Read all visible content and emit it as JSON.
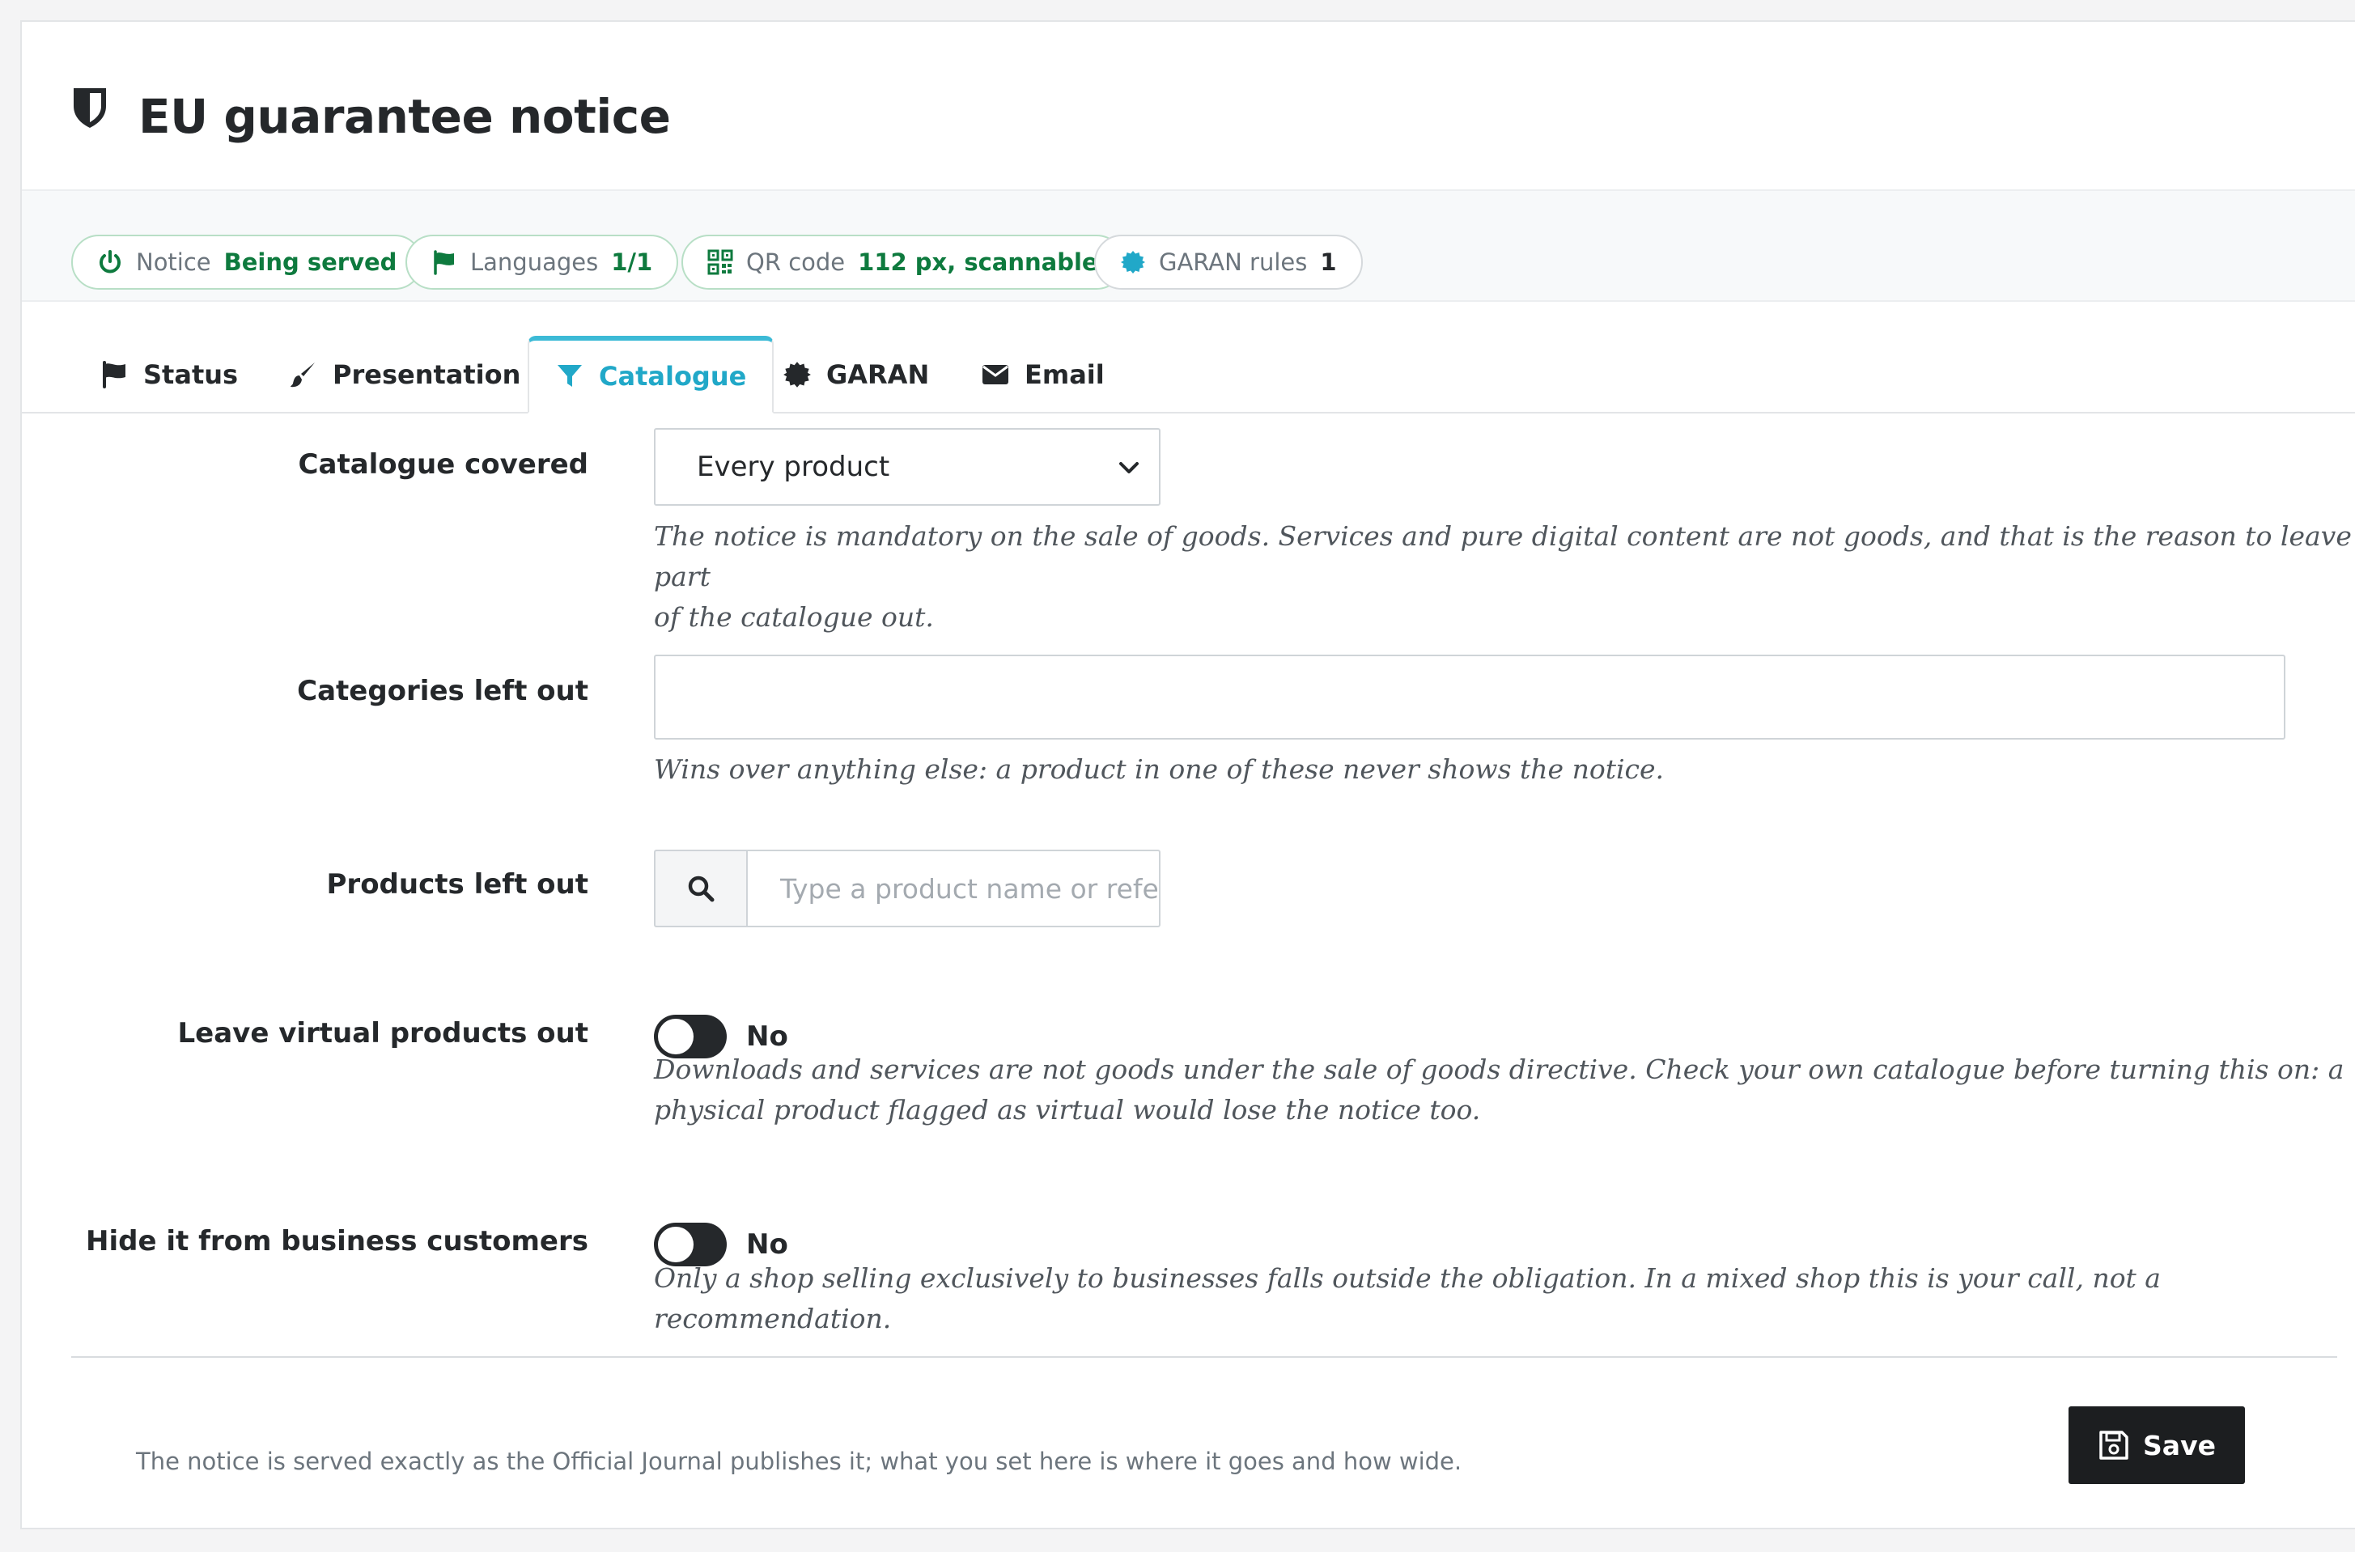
{
  "header": {
    "title": "EU guarantee notice",
    "icon": "shield-icon"
  },
  "kpis": [
    {
      "icon": "power-icon",
      "label": "Notice",
      "value": "Being served",
      "color": "#0e7a3e"
    },
    {
      "icon": "flag-icon",
      "label": "Languages",
      "value": "1/1",
      "color": "#0e7a3e"
    },
    {
      "icon": "qr-code-icon",
      "label": "QR code",
      "value": "112 px, scannable",
      "color": "#0e7a3e"
    },
    {
      "icon": "badge-icon",
      "label": "GARAN rules",
      "value": "1",
      "color": "#25282b"
    }
  ],
  "tabs": [
    {
      "icon": "flag-icon",
      "label": "Status",
      "active": false
    },
    {
      "icon": "brush-icon",
      "label": "Presentation",
      "active": false
    },
    {
      "icon": "filter-icon",
      "label": "Catalogue",
      "active": true
    },
    {
      "icon": "badge-icon",
      "label": "GARAN",
      "active": false
    },
    {
      "icon": "envelope-icon",
      "label": "Email",
      "active": false
    }
  ],
  "form": {
    "catalogue_covered": {
      "label": "Catalogue covered",
      "value": "Every product",
      "help_line1": "The notice is mandatory on the sale of goods. Services and pure digital content are not goods, and that is the reason to leave part",
      "help_line2": "of the catalogue out."
    },
    "categories_left_out": {
      "label": "Categories left out",
      "value": "",
      "help": "Wins over anything else: a product in one of these never shows the notice."
    },
    "products_left_out": {
      "label": "Products left out",
      "placeholder": "Type a product name or reference"
    },
    "leave_virtual_out": {
      "label": "Leave virtual products out",
      "state": "No",
      "help_line1": "Downloads and services are not goods under the sale of goods directive. Check your own catalogue before turning this on: a",
      "help_line2": "physical product flagged as virtual would lose the notice too."
    },
    "hide_business": {
      "label": "Hide it from business customers",
      "state": "No",
      "help": "Only a shop selling exclusively to businesses falls outside the obligation. In a mixed shop this is your call, not a recommendation."
    }
  },
  "footer": {
    "note": "The notice is served exactly as the Official Journal publishes it; what you set here is where it goes and how wide.",
    "save_label": "Save"
  },
  "colors": {
    "accent": "#21a8c8",
    "success": "#0e7a3e",
    "dark": "#25282b"
  }
}
